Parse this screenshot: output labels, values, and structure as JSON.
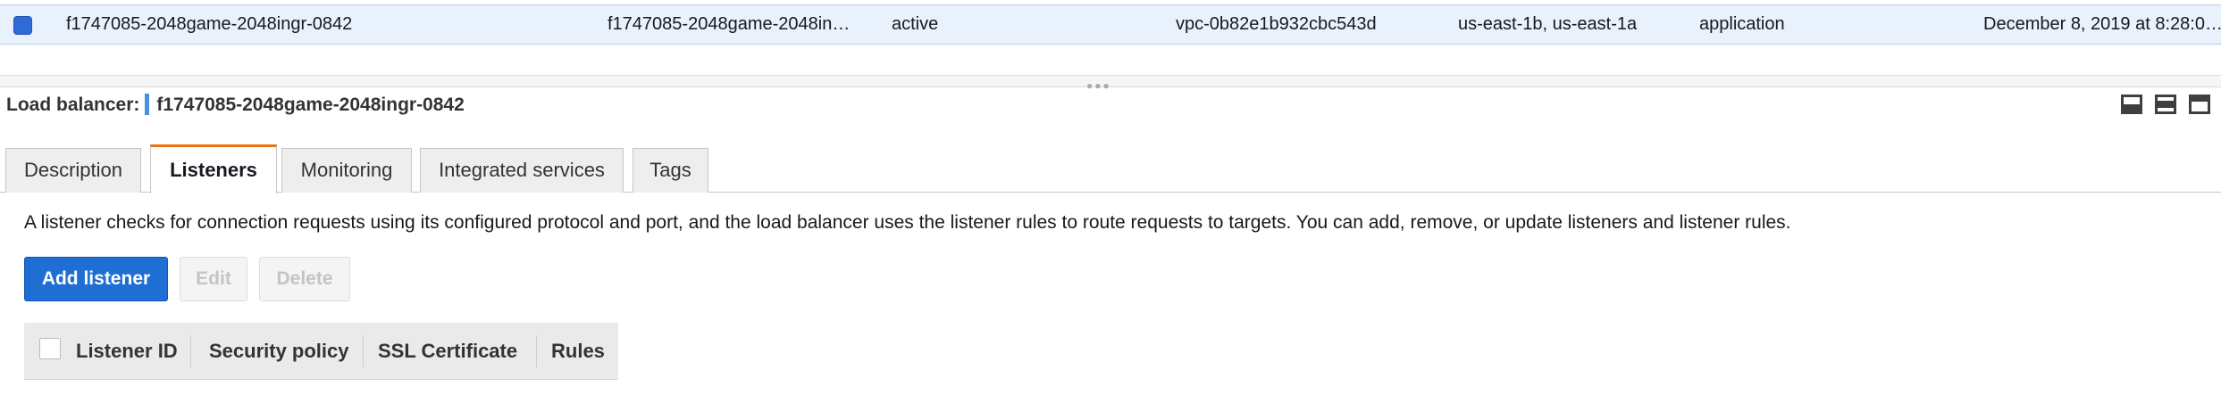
{
  "lb_row": {
    "name": "f1747085-2048game-2048ingr-0842",
    "dns_name": "f1747085-2048game-2048in…",
    "state": "active",
    "vpc_id": "vpc-0b82e1b932cbc543d",
    "availability_zones": "us-east-1b, us-east-1a",
    "type": "application",
    "created_at": "December 8, 2019 at 8:28:0…",
    "selected": true
  },
  "detail": {
    "label": "Load balancer:",
    "name": "f1747085-2048game-2048ingr-0842"
  },
  "layout_buttons": [
    "bottom-pane-icon",
    "split-pane-icon",
    "top-pane-icon"
  ],
  "tabs": [
    {
      "label": "Description",
      "active": false
    },
    {
      "label": "Listeners",
      "active": true
    },
    {
      "label": "Monitoring",
      "active": false
    },
    {
      "label": "Integrated services",
      "active": false
    },
    {
      "label": "Tags",
      "active": false
    }
  ],
  "listeners": {
    "description": "A listener checks for connection requests using its configured protocol and port, and the load balancer uses the listener rules to route requests to targets. You can add, remove, or update listeners and listener rules.",
    "buttons": {
      "add": "Add listener",
      "edit": "Edit",
      "delete": "Delete"
    },
    "columns": [
      "Listener ID",
      "Security policy",
      "SSL Certificate",
      "Rules"
    ]
  },
  "colors": {
    "accent": "#1f6ed4",
    "active_tab": "#ec7211",
    "selected_row": "#e9f1fc"
  }
}
